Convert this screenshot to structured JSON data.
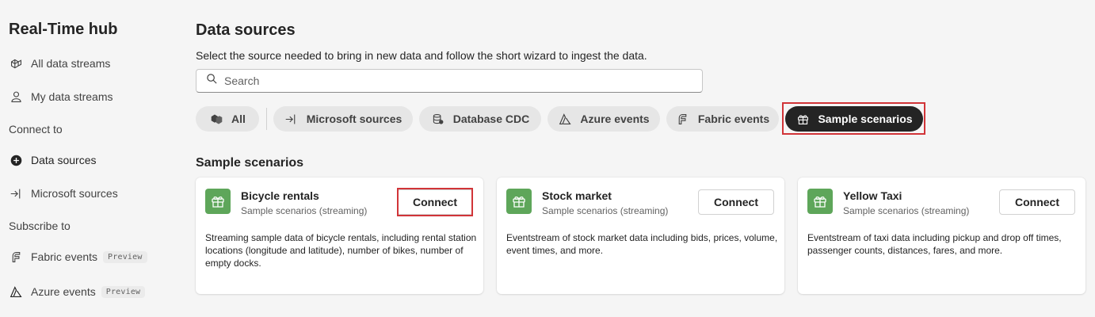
{
  "sidebar": {
    "title": "Real-Time hub",
    "items": [
      {
        "label": "All data streams",
        "icon": "data-streams-icon"
      },
      {
        "label": "My data streams",
        "icon": "person-icon"
      }
    ],
    "connect_header": "Connect to",
    "connect_items": [
      {
        "label": "Data sources",
        "icon": "plus-circle-icon",
        "active": true
      },
      {
        "label": "Microsoft sources",
        "icon": "arrow-enter-icon"
      }
    ],
    "subscribe_header": "Subscribe to",
    "subscribe_items": [
      {
        "label": "Fabric events",
        "icon": "fabric-events-icon",
        "badge": "Preview"
      },
      {
        "label": "Azure events",
        "icon": "azure-icon",
        "badge": "Preview"
      }
    ]
  },
  "main": {
    "title": "Data sources",
    "description": "Select the source needed to bring in new data and follow the short wizard to ingest the data.",
    "search": {
      "placeholder": "Search",
      "value": ""
    },
    "filters": [
      {
        "label": "All",
        "icon": "all-cubes-icon"
      },
      {
        "label": "Microsoft sources",
        "icon": "arrow-enter-icon"
      },
      {
        "label": "Database CDC",
        "icon": "database-icon"
      },
      {
        "label": "Azure events",
        "icon": "azure-icon"
      },
      {
        "label": "Fabric events",
        "icon": "fabric-events-icon"
      },
      {
        "label": "Sample scenarios",
        "icon": "gift-icon",
        "selected": true
      }
    ],
    "section_title": "Sample scenarios",
    "cards": [
      {
        "title": "Bicycle rentals",
        "subtitle": "Sample scenarios (streaming)",
        "button": "Connect",
        "description": "Streaming sample data of bicycle rentals, including rental station locations (longitude and latitude), number of bikes, number of empty docks."
      },
      {
        "title": "Stock market",
        "subtitle": "Sample scenarios (streaming)",
        "button": "Connect",
        "description": "Eventstream of stock market data including bids, prices, volume, event times, and more."
      },
      {
        "title": "Yellow Taxi",
        "subtitle": "Sample scenarios (streaming)",
        "button": "Connect",
        "description": "Eventstream of taxi data including pickup and drop off times, passenger counts, distances, fares, and more."
      }
    ]
  },
  "colors": {
    "accent_green": "#5ea65a",
    "selected_pill": "#242424",
    "highlight": "#d13438"
  }
}
